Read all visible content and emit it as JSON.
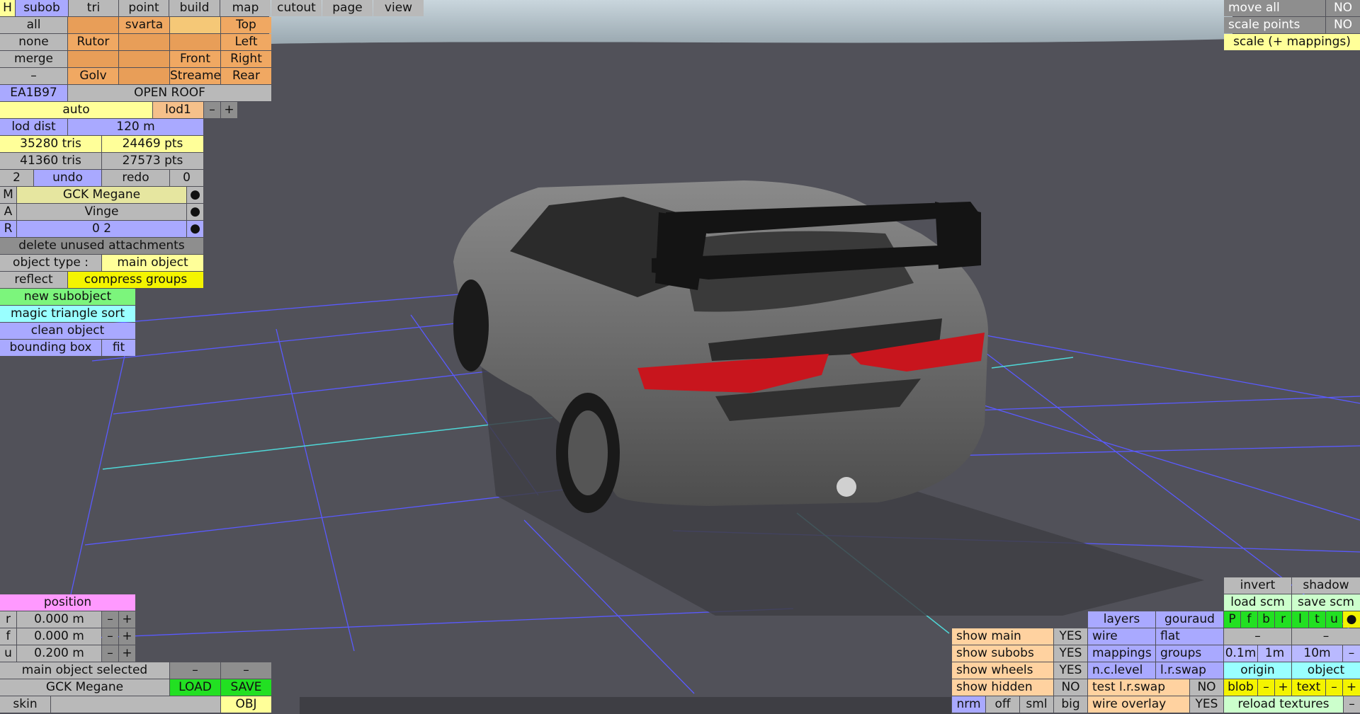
{
  "menu": {
    "tabs": [
      "H",
      "subob",
      "tri",
      "point",
      "build",
      "map",
      "cutout",
      "page",
      "view"
    ],
    "active": "subob"
  },
  "views": {
    "all": "all",
    "none": "none",
    "merge": "merge",
    "minus": "–",
    "rutor": "Rutor",
    "golv": "Golv",
    "svarta": "svarta",
    "front": "Front",
    "streame": "Streame",
    "top": "Top",
    "left": "Left",
    "right": "Right",
    "rear": "Rear"
  },
  "object": {
    "code": "EA1B97",
    "roof": "OPEN ROOF",
    "auto": "auto",
    "lod": "lod1",
    "minus": "–",
    "plus": "+",
    "lod_dist_label": "lod dist",
    "lod_dist_value": "120 m",
    "tris1": "35280 tris",
    "pts1": "24469 pts",
    "tris2": "41360 tris",
    "pts2": "27573 pts",
    "undo_count": "2",
    "undo": "undo",
    "redo": "redo",
    "redo_count": "0",
    "m_key": "M",
    "m_value": "GCK Megane",
    "a_key": "A",
    "a_value": "Vinge",
    "r_key": "R",
    "r_value": "0 2",
    "dot": "●",
    "delete_unused": "delete unused attachments",
    "object_type_label": "object type :",
    "object_type_value": "main object",
    "reflect": "reflect",
    "compress_groups": "compress groups",
    "new_subobject": "new subobject",
    "magic_sort": "magic triangle sort",
    "clean_object": "clean object",
    "bounding_box": "bounding box",
    "fit": "fit"
  },
  "top_right": {
    "move_all": "move all",
    "move_all_val": "NO",
    "scale_points": "scale points",
    "scale_points_val": "NO",
    "scale_mappings": "scale (+ mappings)"
  },
  "position": {
    "title": "position",
    "rows": [
      {
        "axis": "r",
        "value": "0.000 m"
      },
      {
        "axis": "f",
        "value": "0.000 m"
      },
      {
        "axis": "u",
        "value": "0.200 m"
      }
    ],
    "minus": "–",
    "plus": "+",
    "selected": "main object selected",
    "name": "GCK Megane",
    "load": "LOAD",
    "save": "SAVE",
    "skin": "skin",
    "obj": "OBJ"
  },
  "show": {
    "main": "show main",
    "main_val": "YES",
    "subobs": "show subobs",
    "subobs_val": "YES",
    "wheels": "show wheels",
    "wheels_val": "YES",
    "hidden": "show hidden",
    "hidden_val": "NO",
    "nrm": "nrm",
    "off": "off",
    "sml": "sml",
    "big": "big"
  },
  "render": {
    "layers": "layers",
    "gouraud": "gouraud",
    "wire": "wire",
    "flat": "flat",
    "mappings": "mappings",
    "groups": "groups",
    "nclevel": "n.c.level",
    "lrswap": "l.r.swap",
    "test_lr": "test l.r.swap",
    "test_lr_val": "NO",
    "wire_overlay": "wire overlay",
    "wire_overlay_val": "YES"
  },
  "right": {
    "invert": "invert",
    "shadow": "shadow",
    "load_scm": "load scm",
    "save_scm": "save scm",
    "flags": [
      "P",
      "f",
      "b",
      "r",
      "l",
      "t",
      "u",
      "●"
    ],
    "dash": "–",
    "s01": "0.1m",
    "s1": "1m",
    "s10": "10m",
    "origin": "origin",
    "object": "object",
    "blob": "blob",
    "text": "text",
    "minus": "–",
    "plus": "+",
    "reload": "reload textures"
  },
  "colors": {
    "background": "#515159",
    "sky": "#b6c6d0",
    "grid": "#5a5aff",
    "grid_axis": "#4fd8d8",
    "car_body": "#6e6e6e",
    "wing": "#1a1a1a",
    "tail_light": "#c8151d"
  }
}
